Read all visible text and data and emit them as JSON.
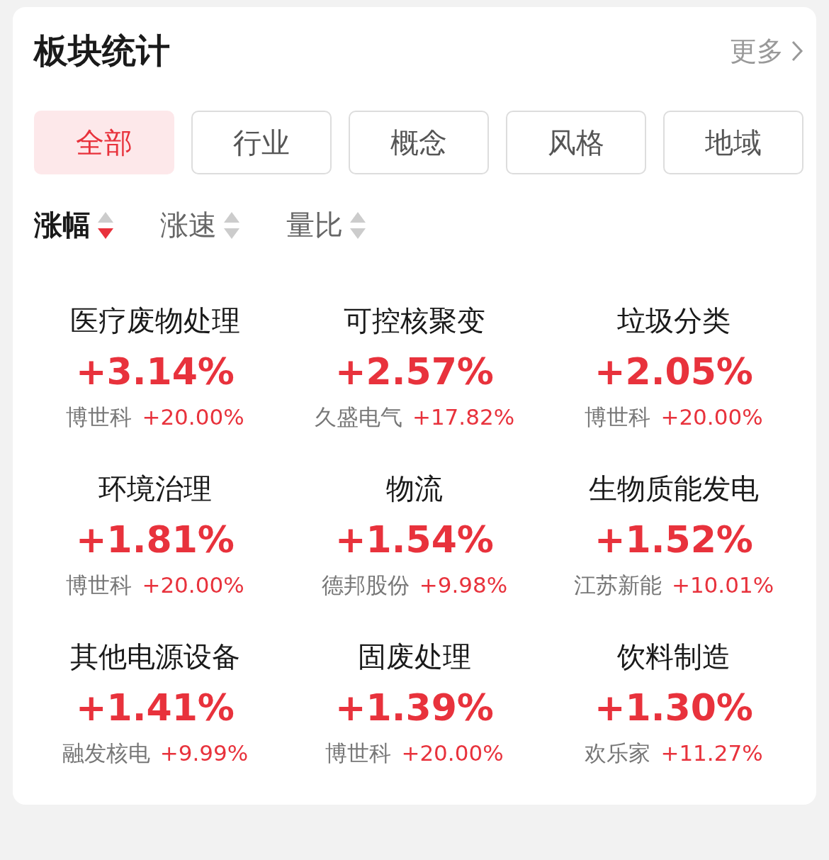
{
  "header": {
    "title": "板块统计",
    "more": "更多"
  },
  "tabs": [
    {
      "label": "全部",
      "selected": true
    },
    {
      "label": "行业",
      "selected": false
    },
    {
      "label": "概念",
      "selected": false
    },
    {
      "label": "风格",
      "selected": false
    },
    {
      "label": "地域",
      "selected": false
    }
  ],
  "sorts": [
    {
      "label": "涨幅",
      "selected": true,
      "descending": true
    },
    {
      "label": "涨速",
      "selected": false,
      "descending": false
    },
    {
      "label": "量比",
      "selected": false,
      "descending": false
    }
  ],
  "sectors": [
    {
      "name": "医疗废物处理",
      "change": "+3.14%",
      "leader": "博世科",
      "leader_change": "+20.00%"
    },
    {
      "name": "可控核聚变",
      "change": "+2.57%",
      "leader": "久盛电气",
      "leader_change": "+17.82%"
    },
    {
      "name": "垃圾分类",
      "change": "+2.05%",
      "leader": "博世科",
      "leader_change": "+20.00%"
    },
    {
      "name": "环境治理",
      "change": "+1.81%",
      "leader": "博世科",
      "leader_change": "+20.00%"
    },
    {
      "name": "物流",
      "change": "+1.54%",
      "leader": "德邦股份",
      "leader_change": "+9.98%"
    },
    {
      "name": "生物质能发电",
      "change": "+1.52%",
      "leader": "江苏新能",
      "leader_change": "+10.01%"
    },
    {
      "name": "其他电源设备",
      "change": "+1.41%",
      "leader": "融发核电",
      "leader_change": "+9.99%"
    },
    {
      "name": "固废处理",
      "change": "+1.39%",
      "leader": "博世科",
      "leader_change": "+20.00%"
    },
    {
      "name": "饮料制造",
      "change": "+1.30%",
      "leader": "欢乐家",
      "leader_change": "+11.27%"
    }
  ]
}
